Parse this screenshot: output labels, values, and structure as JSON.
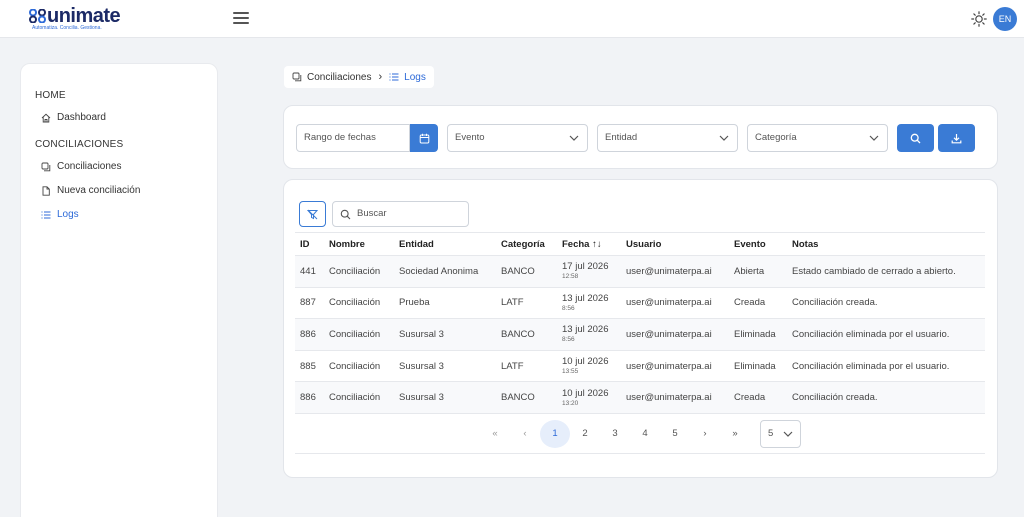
{
  "header": {
    "logo_text": "unimate",
    "logo_tagline": "Automatiza. Concilia. Gestiona.",
    "lang": "EN"
  },
  "sidebar": {
    "sections": [
      {
        "title": "HOME",
        "items": [
          {
            "label": "Dashboard",
            "icon": "home-icon"
          }
        ]
      },
      {
        "title": "CONCILIACIONES",
        "items": [
          {
            "label": "Conciliaciones",
            "icon": "copy-icon"
          },
          {
            "label": "Nueva conciliación",
            "icon": "file-icon"
          },
          {
            "label": "Logs",
            "icon": "list-icon",
            "active": true
          }
        ]
      }
    ]
  },
  "breadcrumb": {
    "parent": "Conciliaciones",
    "current": "Logs"
  },
  "filters": {
    "date_placeholder": "Rango de fechas",
    "event": "Evento",
    "entity": "Entidad",
    "category": "Categoría"
  },
  "table": {
    "search_placeholder": "Buscar",
    "columns": [
      "ID",
      "Nombre",
      "Entidad",
      "Categoría",
      "Fecha ↑↓",
      "Usuario",
      "Evento",
      "Notas"
    ],
    "rows": [
      {
        "id": "441",
        "nombre": "Conciliación",
        "entidad": "Sociedad Anonima",
        "categoria": "BANCO",
        "fecha": "17 jul 2026",
        "hora": "12:58",
        "usuario": "user@unimaterpa.ai",
        "evento": "Abierta",
        "notas": "Estado cambiado de cerrado a abierto."
      },
      {
        "id": "887",
        "nombre": "Conciliación",
        "entidad": "Prueba",
        "categoria": "LATF",
        "fecha": "13 jul 2026",
        "hora": "8:56",
        "usuario": "user@unimaterpa.ai",
        "evento": "Creada",
        "notas": "Conciliación creada."
      },
      {
        "id": "886",
        "nombre": "Conciliación",
        "entidad": "Susursal 3",
        "categoria": "BANCO",
        "fecha": "13 jul 2026",
        "hora": "8:56",
        "usuario": "user@unimaterpa.ai",
        "evento": "Eliminada",
        "notas": "Conciliación eliminada por el usuario."
      },
      {
        "id": "885",
        "nombre": "Conciliación",
        "entidad": "Susursal 3",
        "categoria": "LATF",
        "fecha": "10 jul 2026",
        "hora": "13:55",
        "usuario": "user@unimaterpa.ai",
        "evento": "Eliminada",
        "notas": "Conciliación eliminada por el usuario."
      },
      {
        "id": "886",
        "nombre": "Conciliación",
        "entidad": "Susursal 3",
        "categoria": "BANCO",
        "fecha": "10 jul 2026",
        "hora": "13:20",
        "usuario": "user@unimaterpa.ai",
        "evento": "Creada",
        "notas": "Conciliación creada."
      }
    ]
  },
  "pagination": {
    "first": "«",
    "prev": "‹",
    "next": "›",
    "last": "»",
    "pages": [
      "1",
      "2",
      "3",
      "4",
      "5"
    ],
    "current": "1",
    "rows_per_page": "5"
  },
  "colors": {
    "accent": "#3a7bd5",
    "brand_dark": "#1c2a66"
  }
}
